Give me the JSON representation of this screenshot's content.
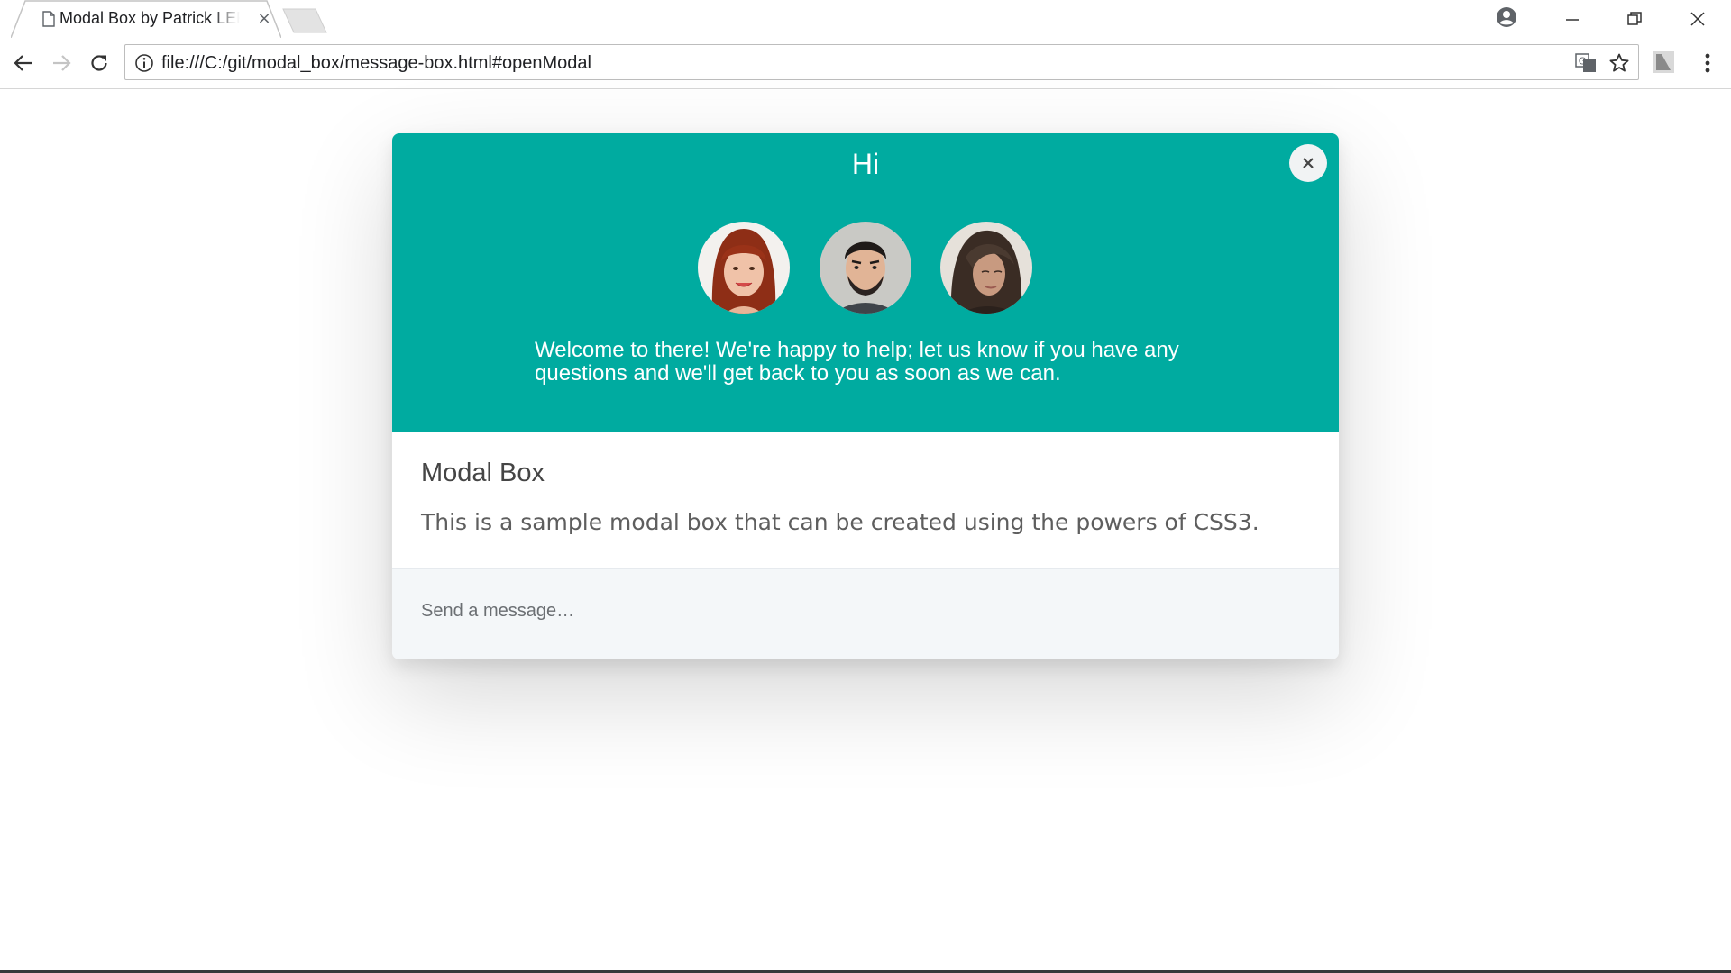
{
  "browser": {
    "tab": {
      "title": "Modal Box by Patrick LEFEBVRE",
      "close_label": "×"
    },
    "address_bar": {
      "url": "file:///C:/git/modal_box/message-box.html#openModal"
    }
  },
  "modal": {
    "heading": "Hi",
    "close_label": "×",
    "accent_color": "#00aba0",
    "avatars": [
      {
        "icon": "avatar-woman-red-hair"
      },
      {
        "icon": "avatar-man-beard"
      },
      {
        "icon": "avatar-woman-dark-hair"
      }
    ],
    "welcome_line1": "Welcome to there! We're happy to help; let us know if you have any",
    "welcome_line2": "questions and we'll get back to you as soon as we can.",
    "body_title": "Modal Box",
    "body_text": "This is a sample modal box that can be created using the powers of CSS3.",
    "message_placeholder": "Send a message…"
  }
}
